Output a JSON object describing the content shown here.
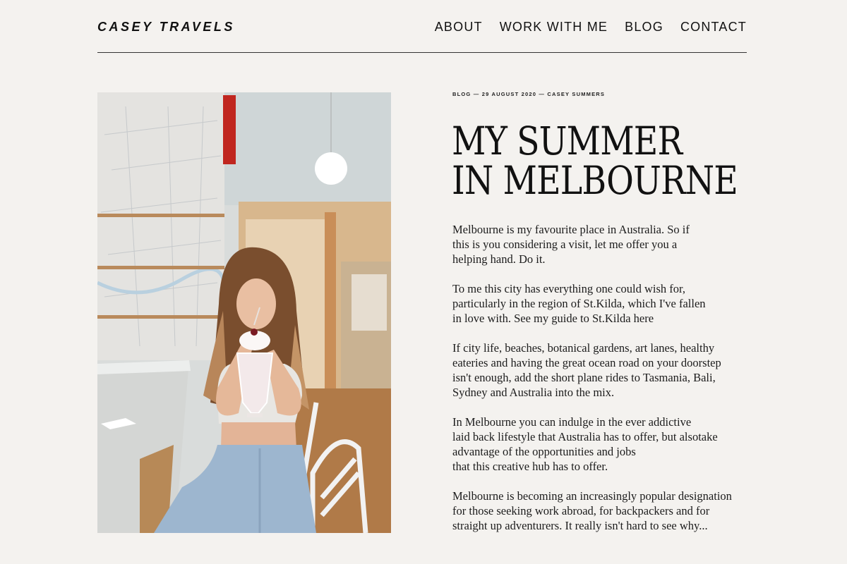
{
  "brand": "CASEY TRAVELS",
  "nav": [
    "ABOUT",
    "WORK WITH ME",
    "BLOG",
    "CONTACT"
  ],
  "post": {
    "meta": "BLOG — 29 AUGUST 2020 — CASEY SUMMERS",
    "title": "MY SUMMER\nIN MELBOURNE",
    "paragraphs": [
      "Melbourne is my favourite place in Australia. So if\nthis is you considering a visit, let me offer you a\nhelping hand. Do it.",
      "To me this city has everything one could wish for,\nparticularly in the region of St.Kilda, which I've fallen\nin love with. See my guide to St.Kilda here",
      "If city life, beaches, botanical gardens, art lanes, healthy\neateries and having the great ocean road on your doorstep\nisn't enough, add the short plane rides to Tasmania, Bali,\nSydney and Australia into the mix.",
      "In Melbourne you can indulge in the ever addictive\nlaid back lifestyle that Australia has to offer, but alsotake\nadvantage of the opportunities and jobs\nthat this creative hub has to offer.",
      "Melbourne is becoming an increasingly popular designation\nfor those seeking work abroad, for backpackers and for\nstraight up adventurers. It really isn't hard to see why..."
    ]
  },
  "colors": {
    "background": "#f4f2ef",
    "text": "#111111"
  }
}
